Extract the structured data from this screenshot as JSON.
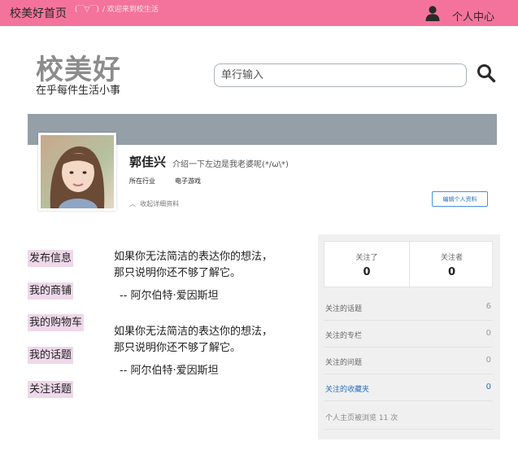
{
  "topbar": {
    "home_link": "校美好首页",
    "kaomoji": "(￣▽￣)",
    "welcome": "/ 欢迎来到校生活",
    "user_center": "个人中心"
  },
  "brand": {
    "logo": "校美好",
    "slogan": "在乎每件生活小事"
  },
  "search": {
    "placeholder": "单行输入"
  },
  "profile": {
    "name": "郭佳兴",
    "intro": "介绍一下左边是我老婆呢(*/ω\\*)",
    "industry_label": "所在行业",
    "industry_value": "电子游戏",
    "collapse_label": "收起详细资料",
    "edit_button": "编辑个人资料"
  },
  "side_nav": [
    {
      "label": "发布信息"
    },
    {
      "label": "我的商铺"
    },
    {
      "label": "我的购物车"
    },
    {
      "label": "我的话题"
    },
    {
      "label": "关注话题"
    }
  ],
  "quotes": [
    {
      "text": "如果你无法简洁的表达你的想法，那只说明你还不够了解它。",
      "author": "-- 阿尔伯特·爱因斯坦"
    },
    {
      "text": "如果你无法简洁的表达你的想法，那只说明你还不够了解它。",
      "author": "-- 阿尔伯特·爱因斯坦"
    }
  ],
  "follow": {
    "following_label": "关注了",
    "following_count": "0",
    "followers_label": "关注者",
    "followers_count": "0"
  },
  "stats": [
    {
      "label": "关注的话题",
      "count": "6",
      "active": false
    },
    {
      "label": "关注的专栏",
      "count": "0",
      "active": false
    },
    {
      "label": "关注的问题",
      "count": "0",
      "active": false
    },
    {
      "label": "关注的收藏夹",
      "count": "0",
      "active": true
    }
  ],
  "views_text": "个人主页被浏览 11 次",
  "colors": {
    "topbar": "#f3739c",
    "cover": "#959fa8",
    "nav_highlight": "#eed8ea",
    "accent_blue": "#2a6fba"
  }
}
